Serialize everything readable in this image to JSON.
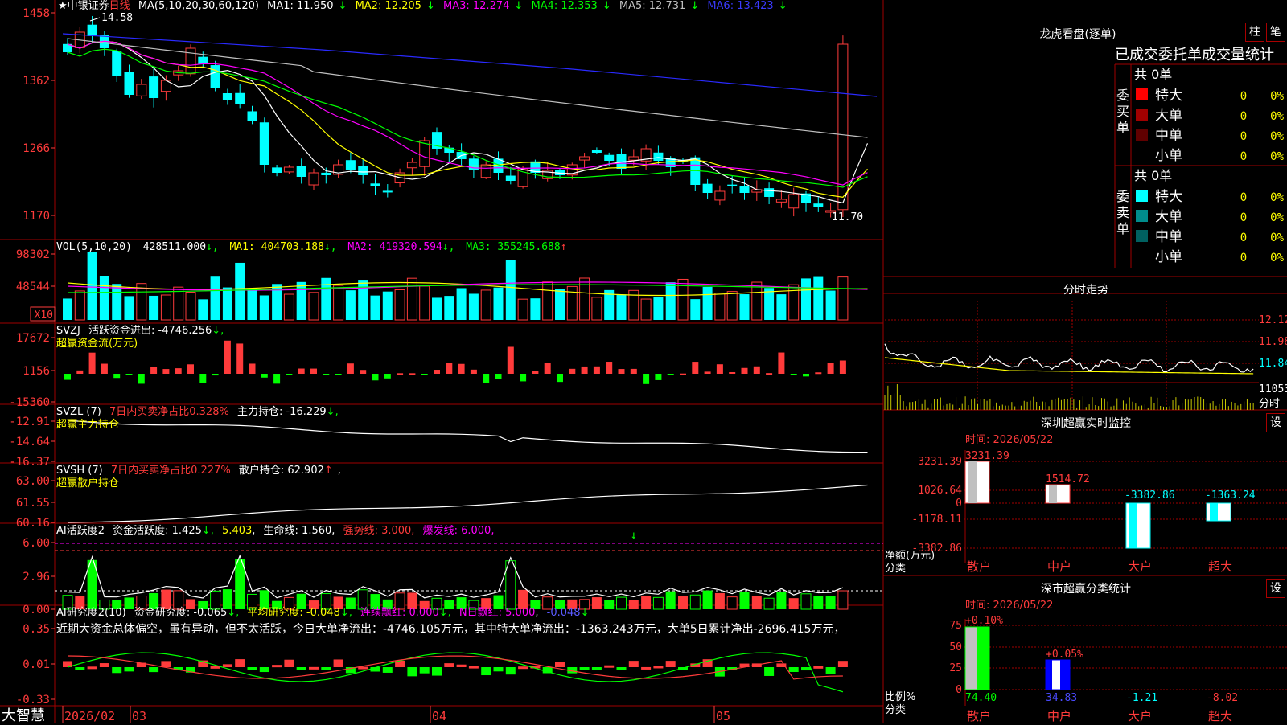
{
  "logo": "大智慧",
  "main": {
    "stock": "★中银证券",
    "period": "日线",
    "ma_formula": "MA(5,10,20,30,60,120)",
    "ma": [
      {
        "label": "MA1: 11.950",
        "arrow": "↓",
        "color": "#ffffff"
      },
      {
        "label": "MA2: 12.205",
        "arrow": "↓",
        "color": "#ffff00"
      },
      {
        "label": "MA3: 12.274",
        "arrow": "↓",
        "color": "#ff00ff"
      },
      {
        "label": "MA4: 12.353",
        "arrow": "↓",
        "color": "#00ff00"
      },
      {
        "label": "MA5: 12.731",
        "arrow": "↓",
        "color": "#c0c0c0"
      },
      {
        "label": "MA6: 13.423",
        "arrow": "↓",
        "color": "#0000ff"
      }
    ],
    "yticks": [
      "1458",
      "1362",
      "1266",
      "1170"
    ],
    "high_label": "14.58",
    "low_label": "11.70"
  },
  "vol": {
    "title": "VOL(5,10,20)",
    "value": "428511.000",
    "ma1": "MA1: 404703.188",
    "ma2": "MA2: 419320.594",
    "ma3": "MA3: 355245.688",
    "yticks": [
      "98302",
      "48544"
    ],
    "unit": "X10"
  },
  "svzj": {
    "title": "SVZJ",
    "label": "活跃资金进出: -4746.256",
    "sub": "超赢资金流(万元)",
    "yticks": [
      "17672",
      "1156",
      "-15360"
    ]
  },
  "svzl": {
    "title": "SVZL (7)",
    "ratio": "7日内买卖净占比0.328%",
    "label": "主力持仓: -16.229",
    "sub": "超赢主力持仓",
    "yticks": [
      "-12.91",
      "-14.64",
      "-16.37"
    ]
  },
  "svsh": {
    "title": "SVSH (7)",
    "ratio": "7日内买卖净占比0.227%",
    "label": "散户持仓: 62.902",
    "sub": "超赢散户持仓",
    "yticks": [
      "63.00",
      "61.55",
      "60.16"
    ]
  },
  "ai1": {
    "title": "AI活跃度2",
    "active": "资金活跃度: 1.425",
    "v2": "5.403",
    "life": "生命线: 1.560",
    "strong": "强势线: 3.000",
    "burst": "爆发线: 6.000",
    "yticks": [
      "6.00",
      "2.96",
      "0.00"
    ]
  },
  "ai2": {
    "title": "AI研究度2(10)",
    "res": "资金研究度: -0.065",
    "avg": "平均研究度: -0.048",
    "cont": "连续飘红: 0.000",
    "nday": "N日飘红: 5.000",
    "tail": "-0.048",
    "yticks": [
      "0.35",
      "0.01",
      "-0.33"
    ],
    "comment": "近期大资金总体偏空，虽有异动，但不太活跃，今日大单净流出：-4746.105万元，其中特大单净流出：-1363.243万元，大单5日累计净出-2696.415万元，"
  },
  "xaxis": {
    "labels": [
      "2026/02",
      "03",
      "04",
      "05"
    ]
  },
  "right": {
    "lhb_title": "龙虎看盘(逐单)",
    "btn1": "柱",
    "btn2": "笔",
    "stats_title": "已成交委托单成交量统计",
    "buy_side": "委买单",
    "sell_side": "委卖单",
    "buy_total": "共 0单",
    "sell_total": "共 0单",
    "buy_rows": [
      {
        "name": "特大",
        "count": "0",
        "pct": "0%",
        "color": "#ff0000"
      },
      {
        "name": "大单",
        "count": "0",
        "pct": "0%",
        "color": "#a00000"
      },
      {
        "name": "中单",
        "count": "0",
        "pct": "0%",
        "color": "#600000"
      },
      {
        "name": "小单",
        "count": "0",
        "pct": "0%",
        "color": "#000000"
      }
    ],
    "sell_rows": [
      {
        "name": "特大",
        "count": "0",
        "pct": "0%",
        "color": "#00ffff"
      },
      {
        "name": "大单",
        "count": "0",
        "pct": "0%",
        "color": "#008c8c"
      },
      {
        "name": "中单",
        "count": "0",
        "pct": "0%",
        "color": "#006060"
      },
      {
        "name": "小单",
        "count": "0",
        "pct": "0%",
        "color": "#000000"
      }
    ],
    "fs_title": "分时走势",
    "fs_ticks": [
      "12.12",
      "11.98",
      "11.84",
      "11053"
    ],
    "fs_unit": "分时",
    "sz_title": "深圳超赢实时监控",
    "sz_btn": "设",
    "sz_time": "时间: 2026/05/22",
    "sz_ticks": [
      "3231.39",
      "1026.64",
      "0",
      "-1178.11",
      "-3382.86"
    ],
    "sz_values": [
      "3231.39",
      "1514.72",
      "-3382.86",
      "-1363.24"
    ],
    "sz_axis": "净额(万元)",
    "sz_axis2": "分类",
    "cat": [
      "散户",
      "中户",
      "大户",
      "超大"
    ],
    "sc_title": "深市超赢分类统计",
    "sc_btn": "设",
    "sc_time": "时间: 2026/05/22",
    "sc_ticks": [
      "75",
      "50",
      "25",
      "0"
    ],
    "sc_top": [
      "+0.10%",
      "+0.05%"
    ],
    "sc_values": [
      "74.40",
      "34.83",
      "-1.21",
      "-8.02"
    ],
    "sc_axis": "比例%",
    "sc_axis2": "分类"
  }
}
